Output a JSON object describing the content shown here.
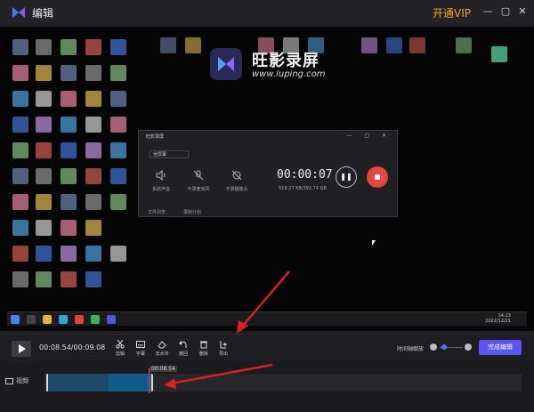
{
  "window": {
    "title": "编辑",
    "vip": "开通VIP",
    "minimize": "—",
    "restore": "▢",
    "close": "✕"
  },
  "preview": {
    "brand_name": "旺影录屏",
    "brand_url": "www.luping.com",
    "taskbar_time": "14:23",
    "taskbar_date": "2022/12/21",
    "recorder": {
      "title": "旺影录屏",
      "mode": "全屏幕",
      "items": [
        "系统声音",
        "不录麦克风",
        "不录摄像头"
      ],
      "timer": "00:00:07",
      "size": "519.27 KB/392.74 GB",
      "footer_left": "文件列表",
      "footer_right": "录制计划"
    }
  },
  "toolbar": {
    "timecode": "00:08.54/00:09.08",
    "tools": [
      {
        "icon": "scissors-icon",
        "label": "剪辑"
      },
      {
        "icon": "subtitle-icon",
        "label": "字幕"
      },
      {
        "icon": "eraser-icon",
        "label": "去水印"
      },
      {
        "icon": "undo-icon",
        "label": "撤回"
      },
      {
        "icon": "trash-icon",
        "label": "删除"
      },
      {
        "icon": "export-icon",
        "label": "导出"
      }
    ],
    "zoom_label": "时间轴缩放",
    "zoom_level": 0.2,
    "finish_button": "完成编辑"
  },
  "timeline": {
    "track_label": "视频",
    "playhead_time": "00:08.54"
  },
  "colors": {
    "accent": "#5b55f5",
    "vip": "#f5a623",
    "playhead": "#e74c3c",
    "clip": "#1b4a6b",
    "clip_selected": "#0e5b8c",
    "record": "#e5473f"
  }
}
